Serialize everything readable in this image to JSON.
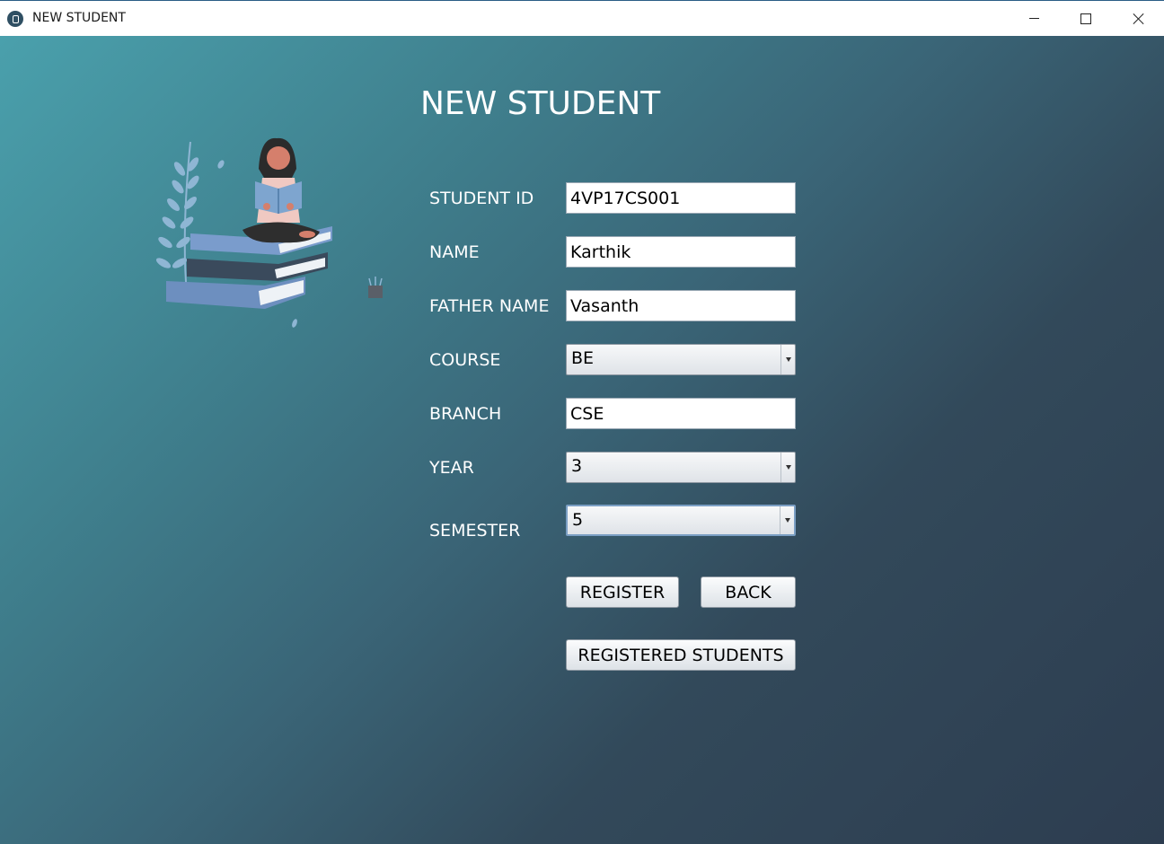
{
  "window": {
    "title": "NEW STUDENT",
    "icon": "app-icon",
    "controls": [
      "minimize-icon",
      "maximize-icon",
      "close-icon"
    ]
  },
  "form": {
    "heading": "NEW STUDENT",
    "fields": {
      "student_id": {
        "label": "STUDENT ID",
        "value": "4VP17CS001"
      },
      "name": {
        "label": "NAME",
        "value": "Karthik"
      },
      "father_name": {
        "label": "FATHER NAME",
        "value": "Vasanth"
      },
      "course": {
        "label": "COURSE",
        "value": "BE"
      },
      "branch": {
        "label": "BRANCH",
        "value": "CSE"
      },
      "year": {
        "label": "YEAR",
        "value": "3"
      },
      "semester": {
        "label": "SEMESTER",
        "value": "5"
      }
    },
    "buttons": {
      "register": "REGISTER",
      "back": "BACK",
      "registered_students": "REGISTERED STUDENTS"
    }
  },
  "colors": {
    "background_start": "#4aa0ac",
    "background_end": "#2d3d50",
    "text": "#ffffff"
  }
}
